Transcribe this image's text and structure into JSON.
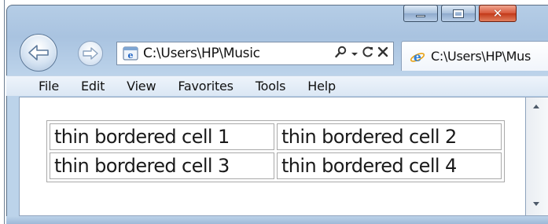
{
  "window": {
    "caption_buttons": [
      "minimize",
      "maximize",
      "close"
    ]
  },
  "nav": {
    "back_icon": "back-arrow-icon",
    "forward_icon": "forward-arrow-icon"
  },
  "address_bar": {
    "value": "C:\\Users\\HP\\Music",
    "page_icon": "ie-page-icon",
    "tools": [
      "search-icon",
      "dropdown-icon",
      "refresh-icon",
      "stop-icon"
    ]
  },
  "tab": {
    "title": "C:\\Users\\HP\\Mus",
    "icon": "ie-logo-icon"
  },
  "menubar": {
    "items": [
      "File",
      "Edit",
      "View",
      "Favorites",
      "Tools",
      "Help"
    ]
  },
  "content": {
    "table": {
      "rows": [
        [
          "thin bordered cell 1",
          "thin bordered cell 2"
        ],
        [
          "thin bordered cell 3",
          "thin bordered cell 4"
        ]
      ]
    }
  },
  "colors": {
    "chrome_blue": "#a9c3e0",
    "close_red": "#c23818",
    "cell_border": "#a9a9a9"
  }
}
